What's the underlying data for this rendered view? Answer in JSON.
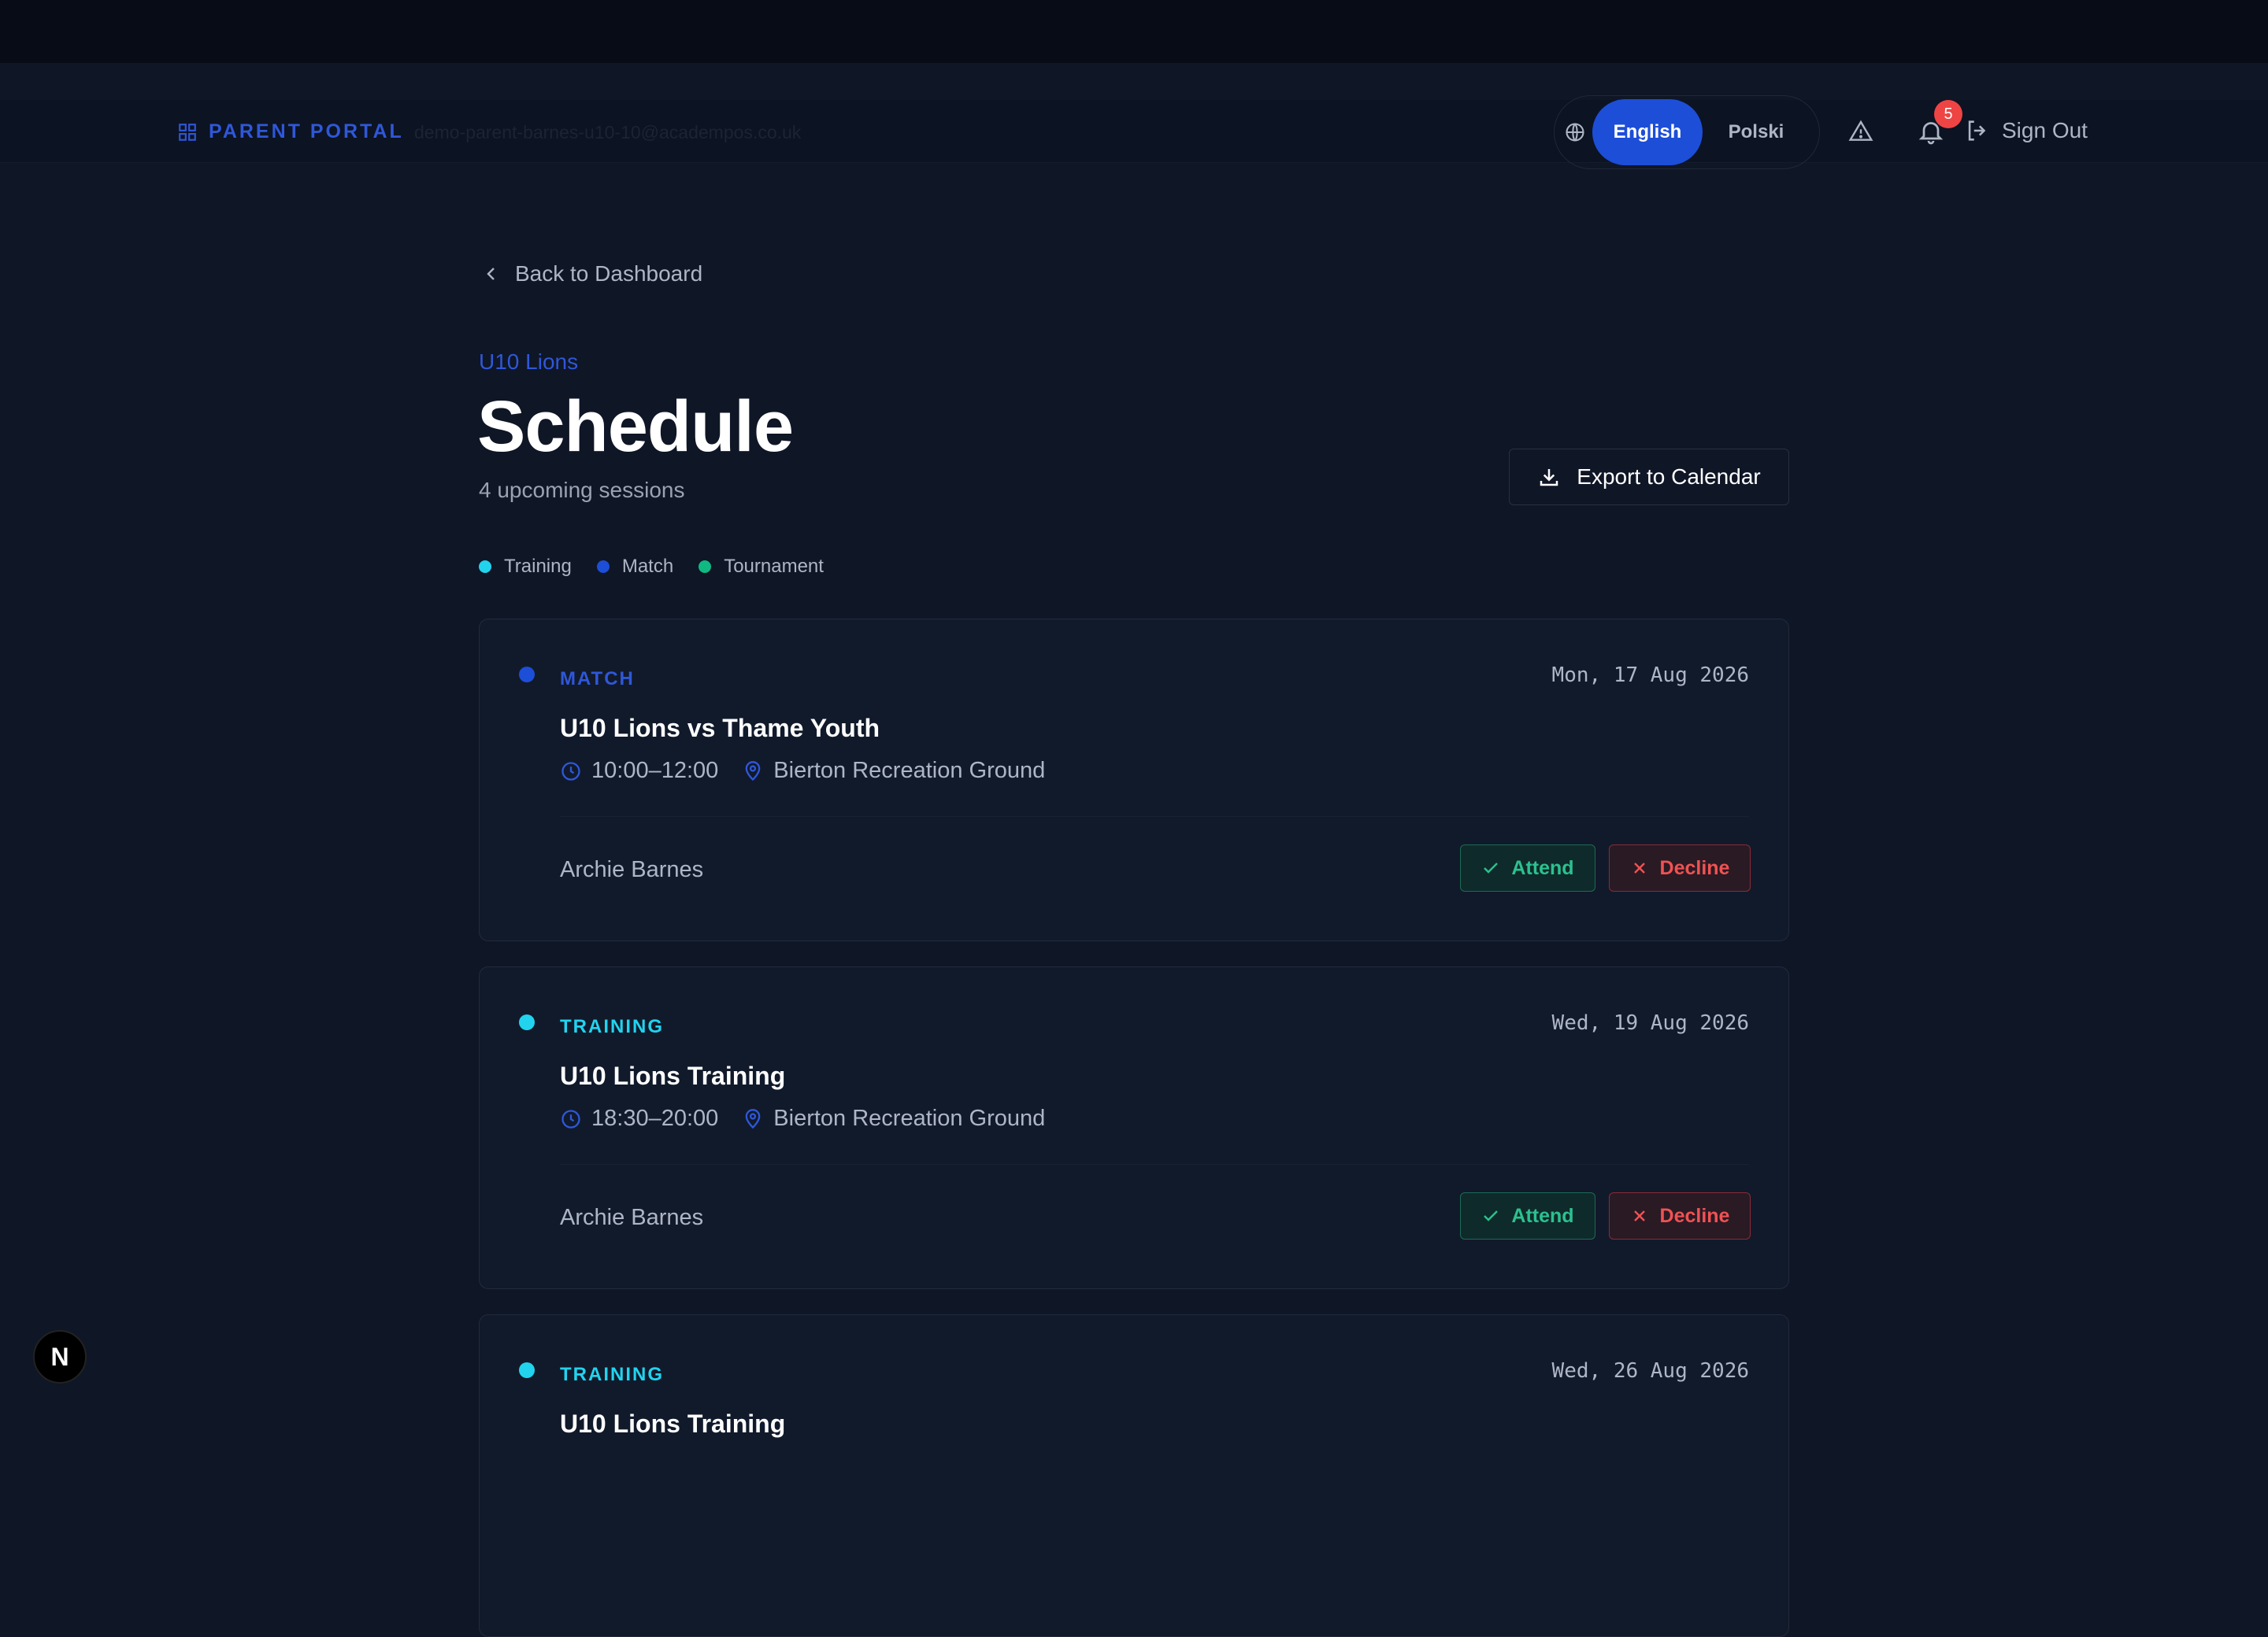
{
  "header": {
    "brand": "PARENT PORTAL",
    "email": "demo-parent-barnes-u10-10@academpos.co.uk",
    "lang_en": "English",
    "lang_pl": "Polski",
    "notifications_count": "5",
    "signout": "Sign Out"
  },
  "page": {
    "back": "Back to Dashboard",
    "team": "U10 Lions",
    "title": "Schedule",
    "subtitle": "4 upcoming sessions",
    "export": "Export to Calendar"
  },
  "legend": [
    {
      "label": "Training",
      "color": "#22d3ee"
    },
    {
      "label": "Match",
      "color": "#1d4ed8"
    },
    {
      "label": "Tournament",
      "color": "#10b981"
    }
  ],
  "colors": {
    "match": "#1d4ed8",
    "training": "#22d3ee",
    "accent": "#2f57d8",
    "attend": "#2cc18f",
    "decline": "#f05252"
  },
  "sessions": [
    {
      "type": "MATCH",
      "date": "Mon, 17 Aug 2026",
      "name": "U10 Lions vs Thame Youth",
      "time": "10:00–12:00",
      "location": "Bierton Recreation Ground",
      "player": "Archie Barnes",
      "attend": "Attend",
      "decline": "Decline"
    },
    {
      "type": "TRAINING",
      "date": "Wed, 19 Aug 2026",
      "name": "U10 Lions Training",
      "time": "18:30–20:00",
      "location": "Bierton Recreation Ground",
      "player": "Archie Barnes",
      "attend": "Attend",
      "decline": "Decline"
    },
    {
      "type": "TRAINING",
      "date": "Wed, 26 Aug 2026",
      "name": "U10 Lions Training"
    }
  ],
  "devtools": {
    "label": "N"
  }
}
